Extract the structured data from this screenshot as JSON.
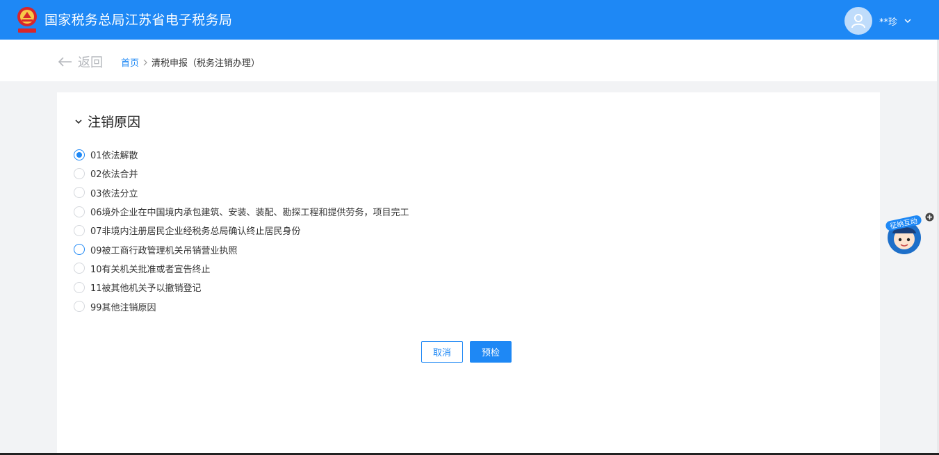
{
  "header": {
    "title": "国家税务总局江苏省电子税务局",
    "user_name": "**珍",
    "logo_icon": "tax-emblem-icon",
    "avatar_icon": "user-avatar-icon",
    "menu_icon": "chevron-down-icon"
  },
  "nav": {
    "back_label": "返回",
    "back_icon": "arrow-left-icon",
    "breadcrumb": {
      "home": "首页",
      "separator_icon": "chevron-right-icon",
      "current": "清税申报（税务注销办理）"
    }
  },
  "form": {
    "section_title": "注销原因",
    "section_icon": "chevron-down-icon",
    "options": [
      {
        "label": "01依法解散",
        "checked": true
      },
      {
        "label": "02依法合并",
        "checked": false
      },
      {
        "label": "03依法分立",
        "checked": false
      },
      {
        "label": "06境外企业在中国境内承包建筑、安装、装配、勘探工程和提供劳务，项目完工",
        "checked": false
      },
      {
        "label": "07非境内注册居民企业经税务总局确认终止居民身份",
        "checked": false
      },
      {
        "label": "09被工商行政管理机关吊销营业执照",
        "checked": false
      },
      {
        "label": "10有关机关批准或者宣告终止",
        "checked": false
      },
      {
        "label": "11被其他机关予以撤销登记",
        "checked": false
      },
      {
        "label": "99其他注销原因",
        "checked": false
      }
    ],
    "cancel_label": "取消",
    "precheck_label": "预检"
  },
  "helper": {
    "label": "征纳互动",
    "icon": "customer-service-mascot-icon",
    "badge_icon": "plus-circle-icon"
  },
  "colors": {
    "brand": "#1e88f5",
    "page_bg": "#f2f3f5"
  }
}
